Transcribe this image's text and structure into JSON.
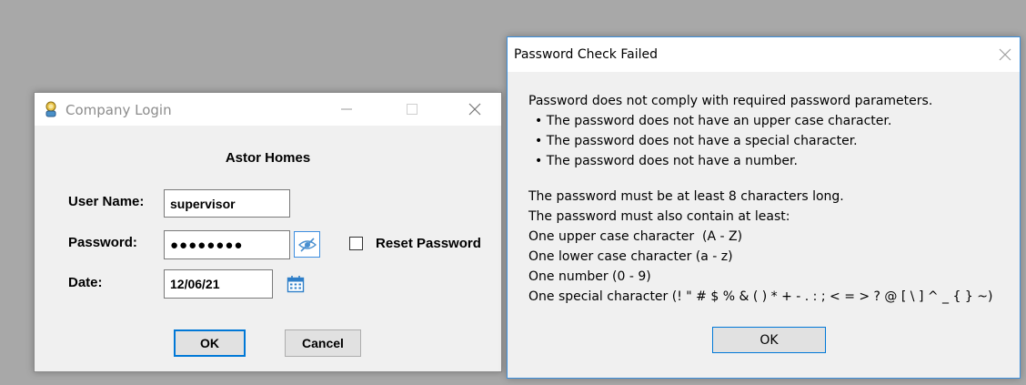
{
  "login": {
    "title": "Company Login",
    "company": "Astor Homes",
    "username_label": "User Name:",
    "username_value": "supervisor",
    "password_label": "Password:",
    "password_value": "●●●●●●●●",
    "reset_label": "Reset Password",
    "date_label": "Date:",
    "date_value": "12/06/21",
    "ok_label": "OK",
    "cancel_label": "Cancel"
  },
  "msgbox": {
    "title": "Password Check Failed",
    "lines": [
      "Password does not comply with required password parameters.",
      "• The password does not have an upper case character.",
      "• The password does not have a special character.",
      "• The password does not have a number.",
      "The password must be at least 8 characters long.",
      "The password must also contain at least:",
      "One upper case character  (A - Z)",
      "One lower case character (a - z)",
      "One number (0 - 9)",
      "One special character (! \" # $ % & ( ) * + - . : ; < = > ? @ [ \\ ] ^ _ { } ~)"
    ],
    "ok_label": "OK"
  }
}
